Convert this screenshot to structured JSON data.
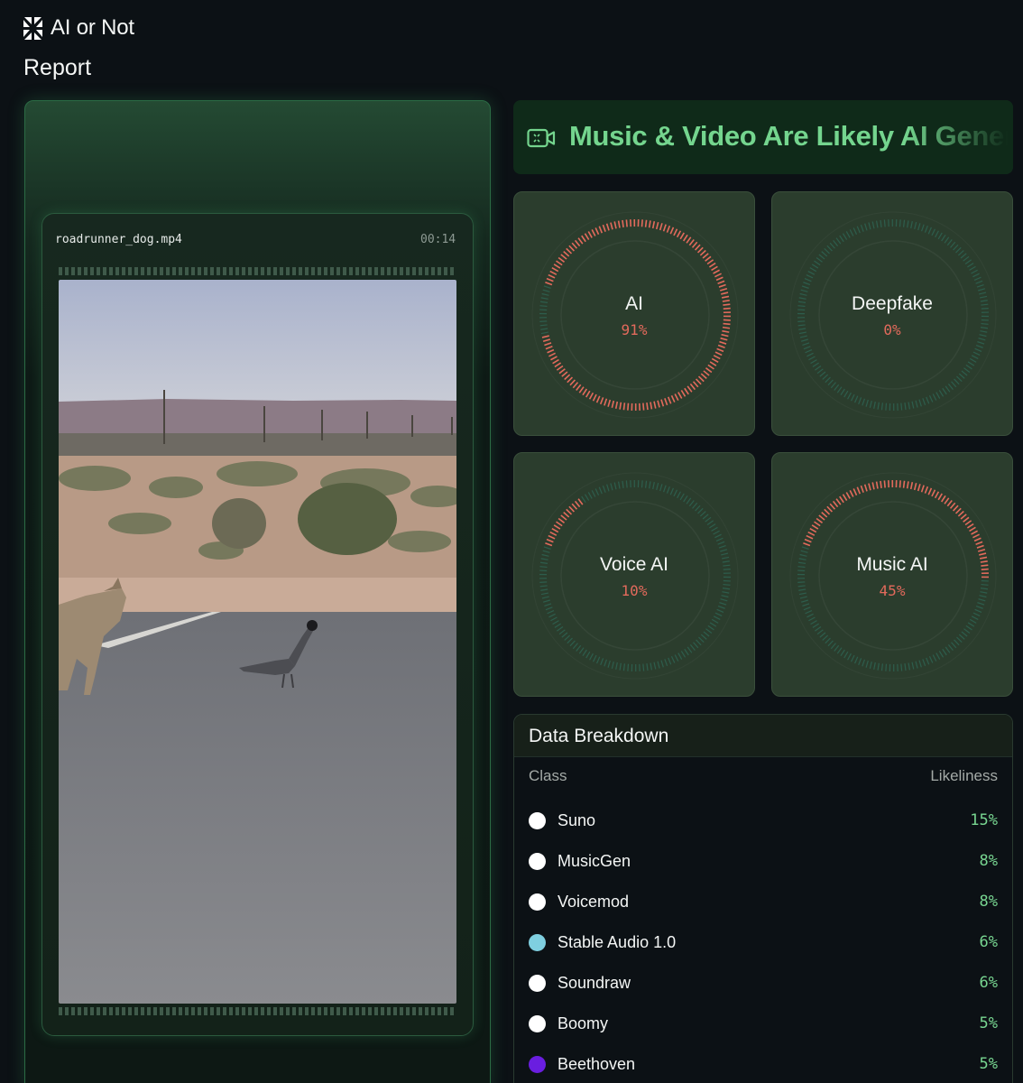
{
  "app": {
    "brand_name": "AI or Not",
    "page_title": "Report"
  },
  "video": {
    "filename": "roadrunner_dog.mp4",
    "duration": "00:14"
  },
  "banner": {
    "icon": "video-camera-icon",
    "text": "Music & Video Are Likely AI Generated",
    "color": "#74d58e"
  },
  "gauges": [
    {
      "label": "AI",
      "value_text": "91%",
      "fraction": 0.91
    },
    {
      "label": "Deepfake",
      "value_text": "0%",
      "fraction": 0.0
    },
    {
      "label": "Voice AI",
      "value_text": "10%",
      "fraction": 0.1
    },
    {
      "label": "Music AI",
      "value_text": "45%",
      "fraction": 0.45
    }
  ],
  "colors": {
    "gauge_active": "#e36a5c",
    "gauge_track": "#2f6b5a",
    "likeliness_value": "#78d691"
  },
  "breakdown": {
    "title": "Data Breakdown",
    "col_class": "Class",
    "col_likeliness": "Likeliness",
    "rows": [
      {
        "name": "Suno",
        "value": "15%",
        "dot_color": "#ffffff"
      },
      {
        "name": "MusicGen",
        "value": "8%",
        "dot_color": "#ffffff"
      },
      {
        "name": "Voicemod",
        "value": "8%",
        "dot_color": "#ffffff"
      },
      {
        "name": "Stable Audio 1.0",
        "value": "6%",
        "dot_color": "#7fcfe0"
      },
      {
        "name": "Soundraw",
        "value": "6%",
        "dot_color": "#ffffff"
      },
      {
        "name": "Boomy",
        "value": "5%",
        "dot_color": "#ffffff"
      },
      {
        "name": "Beethoven",
        "value": "5%",
        "dot_color": "#6a1ee0"
      }
    ]
  }
}
